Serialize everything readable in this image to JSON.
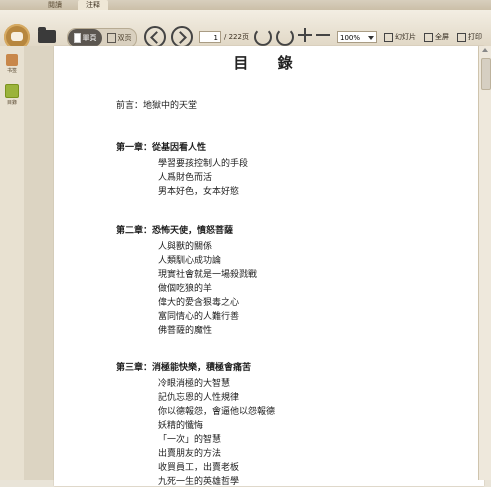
{
  "tabs": [
    "閱讀",
    "注释"
  ],
  "toolbar": {
    "single_page_label": "單頁",
    "double_page_label": "双页",
    "page_current": "1",
    "page_total": "/ 222页",
    "zoom": "100%",
    "slideshow_label": "幻灯片",
    "fullscreen_label": "全屏",
    "print_label": "打印"
  },
  "sidebar": [
    {
      "label": "书签",
      "icon": "book-icon"
    },
    {
      "label": "目錄",
      "icon": "toc-icon"
    }
  ],
  "document": {
    "title": "目 錄",
    "preface": "前言：地獄中的天堂",
    "chapters": [
      {
        "title": "第一章：從基因看人性",
        "items": [
          "學習要孩控制人的手段",
          "人爲財色而活",
          "男本好色，女本好慾"
        ]
      },
      {
        "title": "第二章：恐怖天使，憤怒菩薩",
        "items": [
          "人與獸的關係",
          "人類馴心成功論",
          "現實社會就是一場殺戮戰",
          "做個吃狼的羊",
          "偉大的愛含狠毒之心",
          "富同情心的人難行善",
          "佛菩薩的魔性"
        ]
      },
      {
        "title": "第三章：消極能快樂，積極會痛苦",
        "items": [
          "冷眼消極的大智慧",
          "記仇忘恩的人性規律",
          "你以德報怨，會逼他以怨報德",
          "妖精的懺悔",
          "「一次」的智慧",
          "出賣朋友的方法",
          "收買員工，出賣老板",
          "九死一生的英雄哲學"
        ]
      }
    ]
  },
  "colors": {
    "toolbar_bg": "#e7dfcf",
    "accent": "#5b5650",
    "logo": "#b7873f",
    "toc_green": "#9bb33b"
  }
}
